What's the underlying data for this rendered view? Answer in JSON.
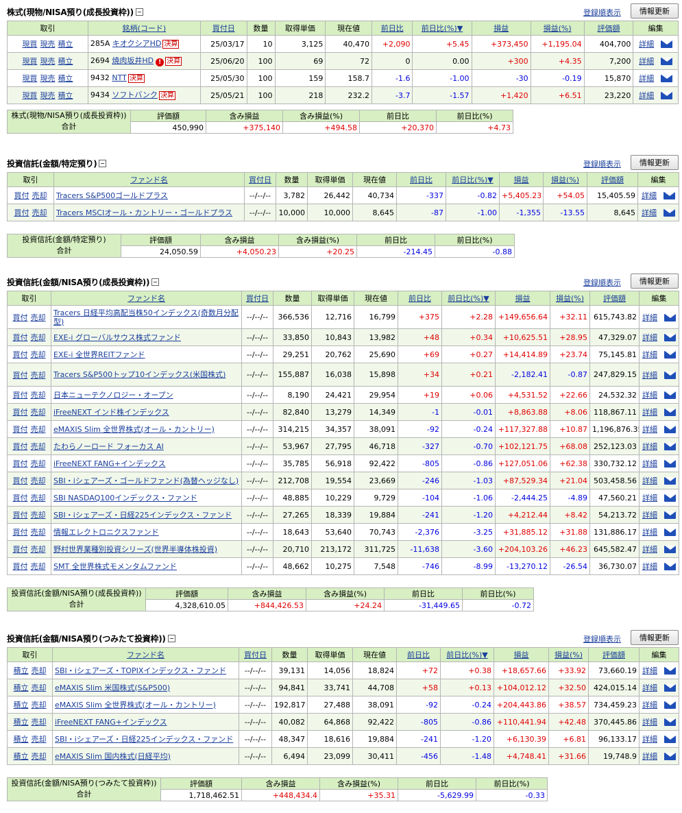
{
  "colors": {
    "header_bg": "#d7efc2",
    "positive": "#e00000",
    "negative": "#0000e0",
    "link": "#1a3e9c"
  },
  "common": {
    "order_link": "登録順表示",
    "refresh_button": "情報更新",
    "detail": "詳細",
    "warn_badge": "決算",
    "mail_icon": "mail-icon"
  },
  "stocks": {
    "title": "株式(現物/NISA預り(成長投資枠))",
    "headers": [
      "取引",
      "銘柄(コード)",
      "買付日",
      "数量",
      "取得単価",
      "現在値",
      "前日比",
      "前日比(%)▼",
      "損益",
      "損益(%)",
      "評価額",
      "編集"
    ],
    "rows": [
      {
        "a1": "現買",
        "a2": "現売",
        "a3": "積立",
        "code": "285A",
        "name": "キオクシアHD",
        "badge": true,
        "alert": false,
        "date": "25/03/17",
        "qty": "10",
        "cost": "3,125",
        "price": "40,470",
        "chg": "+2,090",
        "chgp": "+5.45",
        "pl": "+373,450",
        "plp": "+1,195.04",
        "val": "404,700"
      },
      {
        "a1": "現買",
        "a2": "現売",
        "a3": "積立",
        "code": "2694",
        "name": "焼肉坂井HD",
        "badge": true,
        "alert": true,
        "date": "25/06/20",
        "qty": "100",
        "cost": "69",
        "price": "72",
        "chg": "0",
        "chgp": "0.00",
        "pl": "+300",
        "plp": "+4.35",
        "val": "7,200"
      },
      {
        "a1": "現買",
        "a2": "現売",
        "a3": "積立",
        "code": "9432",
        "name": "NTT",
        "badge": true,
        "alert": false,
        "date": "25/05/30",
        "qty": "100",
        "cost": "159",
        "price": "158.7",
        "chg": "-1.6",
        "chgp": "-1.00",
        "pl": "-30",
        "plp": "-0.19",
        "val": "15,870"
      },
      {
        "a1": "現買",
        "a2": "現売",
        "a3": "積立",
        "code": "9434",
        "name": "ソフトバンク",
        "badge": true,
        "alert": false,
        "date": "25/05/21",
        "qty": "100",
        "cost": "218",
        "price": "232.2",
        "chg": "-3.7",
        "chgp": "-1.57",
        "pl": "+1,420",
        "plp": "+6.51",
        "val": "23,220"
      }
    ],
    "summary": {
      "label1": "株式(現物/NISA預り(成長投資枠))",
      "label2": "合計",
      "headers": [
        "評価額",
        "含み損益",
        "含み損益(%)",
        "前日比",
        "前日比(%)"
      ],
      "values": [
        "450,990",
        "+375,140",
        "+494.58",
        "+20,370",
        "+4.73"
      ]
    }
  },
  "fund_tokutei": {
    "title": "投資信託(金額/特定預り)",
    "headers": [
      "取引",
      "ファンド名",
      "買付日",
      "数量",
      "取得単価",
      "現在値",
      "前日比",
      "前日比(%)▼",
      "損益",
      "損益(%)",
      "評価額",
      "編集"
    ],
    "rows": [
      {
        "a1": "買付",
        "a2": "売却",
        "name": "Tracers S&P500ゴールドプラス",
        "date": "--/--/--",
        "qty": "3,782",
        "cost": "26,442",
        "price": "40,734",
        "chg": "-337",
        "chgp": "-0.82",
        "pl": "+5,405.23",
        "plp": "+54.05",
        "val": "15,405.59"
      },
      {
        "a1": "買付",
        "a2": "売却",
        "name": "Tracers MSCIオール・カントリー・ゴールドプラス",
        "date": "--/--/--",
        "qty": "10,000",
        "cost": "10,000",
        "price": "8,645",
        "chg": "-87",
        "chgp": "-1.00",
        "pl": "-1,355",
        "plp": "-13.55",
        "val": "8,645"
      }
    ],
    "summary": {
      "label1": "投資信託(金額/特定預り)",
      "label2": "合計",
      "headers": [
        "評価額",
        "含み損益",
        "含み損益(%)",
        "前日比",
        "前日比(%)"
      ],
      "values": [
        "24,050.59",
        "+4,050.23",
        "+20.25",
        "-214.45",
        "-0.88"
      ]
    }
  },
  "fund_seicho": {
    "title": "投資信託(金額/NISA預り(成長投資枠))",
    "headers": [
      "取引",
      "ファンド名",
      "買付日",
      "数量",
      "取得単価",
      "現在値",
      "前日比",
      "前日比(%)▼",
      "損益",
      "損益(%)",
      "評価額",
      "編集"
    ],
    "rows": [
      {
        "a1": "買付",
        "a2": "売却",
        "tall": true,
        "name": "Tracers 日経平均高配当株50インデックス(奇数月分配型)",
        "date": "--/--/--",
        "qty": "366,536",
        "cost": "12,716",
        "price": "16,799",
        "chg": "+375",
        "chgp": "+2.28",
        "pl": "+149,656.64",
        "plp": "+32.11",
        "val": "615,743.82"
      },
      {
        "a1": "買付",
        "a2": "売却",
        "name": "EXE-i グローバルサウス株式ファンド",
        "date": "--/--/--",
        "qty": "33,850",
        "cost": "10,843",
        "price": "13,982",
        "chg": "+48",
        "chgp": "+0.34",
        "pl": "+10,625.51",
        "plp": "+28.95",
        "val": "47,329.07"
      },
      {
        "a1": "買付",
        "a2": "売却",
        "name": "EXE-i 全世界REITファンド",
        "date": "--/--/--",
        "qty": "29,251",
        "cost": "20,762",
        "price": "25,690",
        "chg": "+69",
        "chgp": "+0.27",
        "pl": "+14,414.89",
        "plp": "+23.74",
        "val": "75,145.81"
      },
      {
        "a1": "買付",
        "a2": "売却",
        "tall": true,
        "name": "Tracers S&P500トップ10インデックス(米国株式)",
        "date": "--/--/--",
        "qty": "155,887",
        "cost": "16,038",
        "price": "15,898",
        "chg": "+34",
        "chgp": "+0.21",
        "pl": "-2,182.41",
        "plp": "-0.87",
        "val": "247,829.15"
      },
      {
        "a1": "買付",
        "a2": "売却",
        "name": "日本ニューテクノロジー・オープン",
        "date": "--/--/--",
        "qty": "8,190",
        "cost": "24,421",
        "price": "29,954",
        "chg": "+19",
        "chgp": "+0.06",
        "pl": "+4,531.52",
        "plp": "+22.66",
        "val": "24,532.32"
      },
      {
        "a1": "買付",
        "a2": "売却",
        "name": "iFreeNEXT インド株インデックス",
        "date": "--/--/--",
        "qty": "82,840",
        "cost": "13,279",
        "price": "14,349",
        "chg": "-1",
        "chgp": "-0.01",
        "pl": "+8,863.88",
        "plp": "+8.06",
        "val": "118,867.11"
      },
      {
        "a1": "買付",
        "a2": "売却",
        "name": "eMAXIS Slim 全世界株式(オール・カントリー)",
        "date": "--/--/--",
        "qty": "314,215",
        "cost": "34,357",
        "price": "38,091",
        "chg": "-92",
        "chgp": "-0.24",
        "pl": "+117,327.88",
        "plp": "+10.87",
        "val": "1,196,876.35"
      },
      {
        "a1": "買付",
        "a2": "売却",
        "name": "たわらノーロード フォーカス AI",
        "date": "--/--/--",
        "qty": "53,967",
        "cost": "27,795",
        "price": "46,718",
        "chg": "-327",
        "chgp": "-0.70",
        "pl": "+102,121.75",
        "plp": "+68.08",
        "val": "252,123.03"
      },
      {
        "a1": "買付",
        "a2": "売却",
        "name": "iFreeNEXT FANG+インデックス",
        "date": "--/--/--",
        "qty": "35,785",
        "cost": "56,918",
        "price": "92,422",
        "chg": "-805",
        "chgp": "-0.86",
        "pl": "+127,051.06",
        "plp": "+62.38",
        "val": "330,732.12"
      },
      {
        "a1": "買付",
        "a2": "売却",
        "name": "SBI・iシェアーズ・ゴールドファンド(為替ヘッジなし)",
        "date": "--/--/--",
        "qty": "212,708",
        "cost": "19,554",
        "price": "23,669",
        "chg": "-246",
        "chgp": "-1.03",
        "pl": "+87,529.34",
        "plp": "+21.04",
        "val": "503,458.56"
      },
      {
        "a1": "買付",
        "a2": "売却",
        "name": "SBI NASDAQ100インデックス・ファンド",
        "date": "--/--/--",
        "qty": "48,885",
        "cost": "10,229",
        "price": "9,729",
        "chg": "-104",
        "chgp": "-1.06",
        "pl": "-2,444.25",
        "plp": "-4.89",
        "val": "47,560.21"
      },
      {
        "a1": "買付",
        "a2": "売却",
        "name": "SBI・iシェアーズ・日経225インデックス・ファンド",
        "date": "--/--/--",
        "qty": "27,265",
        "cost": "18,339",
        "price": "19,884",
        "chg": "-241",
        "chgp": "-1.20",
        "pl": "+4,212.44",
        "plp": "+8.42",
        "val": "54,213.72"
      },
      {
        "a1": "買付",
        "a2": "売却",
        "name": "情報エレクトロニクスファンド",
        "date": "--/--/--",
        "qty": "18,643",
        "cost": "53,640",
        "price": "70,743",
        "chg": "-2,376",
        "chgp": "-3.25",
        "pl": "+31,885.12",
        "plp": "+31.88",
        "val": "131,886.17"
      },
      {
        "a1": "買付",
        "a2": "売却",
        "name": "野村世界業種別投資シリーズ(世界半導体株投資)",
        "date": "--/--/--",
        "qty": "20,710",
        "cost": "213,172",
        "price": "311,725",
        "chg": "-11,638",
        "chgp": "-3.60",
        "pl": "+204,103.26",
        "plp": "+46.23",
        "val": "645,582.47"
      },
      {
        "a1": "買付",
        "a2": "売却",
        "name": "SMT 全世界株式モメンタムファンド",
        "date": "--/--/--",
        "qty": "48,662",
        "cost": "10,275",
        "price": "7,548",
        "chg": "-746",
        "chgp": "-8.99",
        "pl": "-13,270.12",
        "plp": "-26.54",
        "val": "36,730.07"
      }
    ],
    "summary": {
      "label1": "投資信託(金額/NISA預り(成長投資枠))",
      "label2": "合計",
      "headers": [
        "評価額",
        "含み損益",
        "含み損益(%)",
        "前日比",
        "前日比(%)"
      ],
      "values": [
        "4,328,610.05",
        "+844,426.53",
        "+24.24",
        "-31,449.65",
        "-0.72"
      ]
    }
  },
  "fund_tsumitate": {
    "title": "投資信託(金額/NISA預り(つみたて投資枠))",
    "headers": [
      "取引",
      "ファンド名",
      "買付日",
      "数量",
      "取得単価",
      "現在値",
      "前日比",
      "前日比(%)▼",
      "損益",
      "損益(%)",
      "評価額",
      "編集"
    ],
    "rows": [
      {
        "a1": "積立",
        "a2": "売却",
        "name": "SBI・iシェアーズ・TOPIXインデックス・ファンド",
        "date": "--/--/--",
        "qty": "39,131",
        "cost": "14,056",
        "price": "18,824",
        "chg": "+72",
        "chgp": "+0.38",
        "pl": "+18,657.66",
        "plp": "+33.92",
        "val": "73,660.19"
      },
      {
        "a1": "積立",
        "a2": "売却",
        "name": "eMAXIS Slim 米国株式(S&P500)",
        "date": "--/--/--",
        "qty": "94,841",
        "cost": "33,741",
        "price": "44,708",
        "chg": "+58",
        "chgp": "+0.13",
        "pl": "+104,012.12",
        "plp": "+32.50",
        "val": "424,015.14"
      },
      {
        "a1": "積立",
        "a2": "売却",
        "name": "eMAXIS Slim 全世界株式(オール・カントリー)",
        "date": "--/--/--",
        "qty": "192,817",
        "cost": "27,488",
        "price": "38,091",
        "chg": "-92",
        "chgp": "-0.24",
        "pl": "+204,443.86",
        "plp": "+38.57",
        "val": "734,459.23"
      },
      {
        "a1": "積立",
        "a2": "売却",
        "name": "iFreeNEXT FANG+インデックス",
        "date": "--/--/--",
        "qty": "40,082",
        "cost": "64,868",
        "price": "92,422",
        "chg": "-805",
        "chgp": "-0.86",
        "pl": "+110,441.94",
        "plp": "+42.48",
        "val": "370,445.86"
      },
      {
        "a1": "積立",
        "a2": "売却",
        "name": "SBI・iシェアーズ・日経225インデックス・ファンド",
        "date": "--/--/--",
        "qty": "48,347",
        "cost": "18,616",
        "price": "19,884",
        "chg": "-241",
        "chgp": "-1.20",
        "pl": "+6,130.39",
        "plp": "+6.81",
        "val": "96,133.17"
      },
      {
        "a1": "積立",
        "a2": "売却",
        "name": "eMAXIS Slim 国内株式(日経平均)",
        "date": "--/--/--",
        "qty": "6,494",
        "cost": "23,099",
        "price": "30,411",
        "chg": "-456",
        "chgp": "-1.48",
        "pl": "+4,748.41",
        "plp": "+31.66",
        "val": "19,748.9"
      }
    ],
    "summary": {
      "label1": "投資信託(金額/NISA預り(つみたて投資枠))",
      "label2": "合計",
      "headers": [
        "評価額",
        "含み損益",
        "含み損益(%)",
        "前日比",
        "前日比(%)"
      ],
      "values": [
        "1,718,462.51",
        "+448,434.4",
        "+35.31",
        "-5,629.99",
        "-0.33"
      ]
    }
  }
}
